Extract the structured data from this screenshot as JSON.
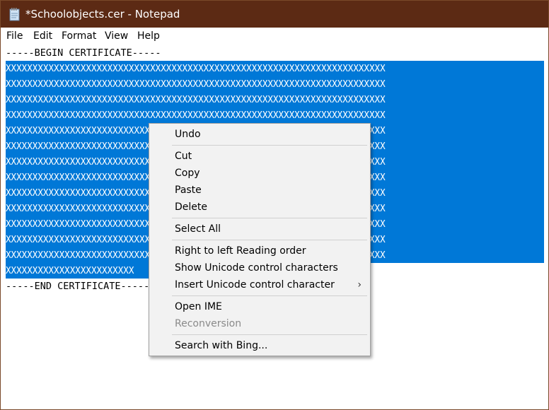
{
  "window": {
    "title": "*Schoolobjects.cer - Notepad"
  },
  "menubar": {
    "items": [
      "File",
      "Edit",
      "Format",
      "View",
      "Help"
    ]
  },
  "editor": {
    "begin_line": "-----BEGIN CERTIFICATE-----",
    "cert_line": "XXXXXXXXXXXXXXXXXXXXXXXXXXXXXXXXXXXXXXXXXXXXXXXXXXXXXXXXXXXXXXXXXXXXXXX",
    "last_line": "XXXXXXXXXXXXXXXXXXXXXXXX",
    "end_line": "-----END CERTIFICATE-----"
  },
  "context_menu": {
    "undo": "Undo",
    "cut": "Cut",
    "copy": "Copy",
    "paste": "Paste",
    "delete": "Delete",
    "select_all": "Select All",
    "rtl_reading_order": "Right to left Reading order",
    "show_unicode": "Show Unicode control characters",
    "insert_unicode": "Insert Unicode control character",
    "submenu_arrow": "›",
    "open_ime": "Open IME",
    "reconversion": "Reconversion",
    "search_bing": "Search with Bing..."
  },
  "colors": {
    "titlebar": "#5c2a14",
    "selection": "#0078d7",
    "menu_background": "#f2f2f2"
  }
}
